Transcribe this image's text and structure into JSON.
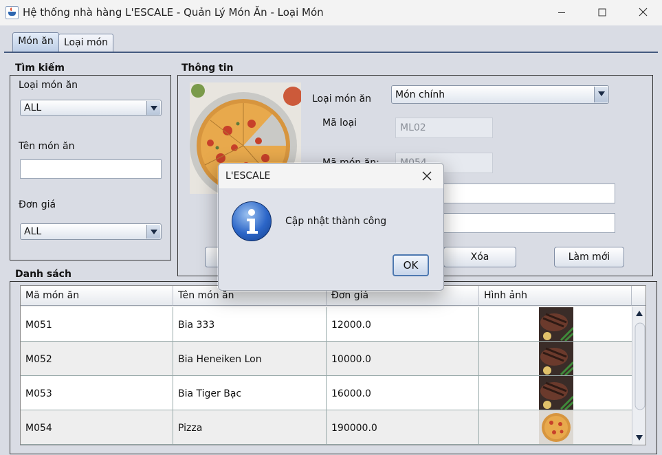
{
  "window": {
    "title": "Hệ thống nhà hàng L'ESCALE - Quản Lý Món Ăn - Loại Món"
  },
  "tabs": [
    {
      "label": "Món ăn",
      "active": true
    },
    {
      "label": "Loại món",
      "active": false
    }
  ],
  "search": {
    "title": "Tìm kiếm",
    "category_label": "Loại món ăn",
    "category_value": "ALL",
    "name_label": "Tên món ăn",
    "name_value": "",
    "price_label": "Đơn giá",
    "price_value": "ALL"
  },
  "info": {
    "title": "Thông tin",
    "image_icon": "pizza-photo",
    "category_label": "Loại món ăn",
    "category_value": "Món chính",
    "type_code_label": "Mã loại",
    "type_code_value": "ML02",
    "item_code_label": "Mã món ăn:",
    "item_code_value": "M054",
    "buttons": {
      "delete": "Xóa",
      "refresh": "Làm mới"
    }
  },
  "list": {
    "title": "Danh sách",
    "columns": [
      "Mã món ăn",
      "Tên món ăn",
      "Đơn giá",
      "Hình ảnh"
    ],
    "rows": [
      {
        "code": "M051",
        "name": "Bia 333",
        "price": "12000.0",
        "image": "steak-photo"
      },
      {
        "code": "M052",
        "name": "Bia Heneiken Lon",
        "price": "10000.0",
        "image": "steak-photo"
      },
      {
        "code": "M053",
        "name": "Bia Tiger Bạc",
        "price": "16000.0",
        "image": "steak-photo"
      },
      {
        "code": "M054",
        "name": "Pizza",
        "price": "190000.0",
        "image": "pizza-photo"
      }
    ]
  },
  "dialog": {
    "title": "L'ESCALE",
    "message": "Cập nhật thành công",
    "ok_label": "OK",
    "icon": "information-icon"
  },
  "colors": {
    "accent": "#2c66c8",
    "tab_active": "#bccde6",
    "background": "#d9dce4"
  }
}
